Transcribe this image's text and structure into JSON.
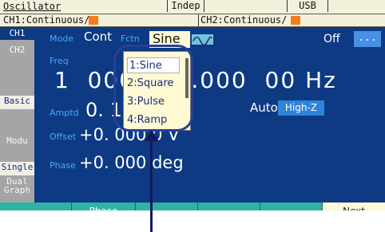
{
  "topbar": {
    "title": "Oscillator",
    "indep": "Indep",
    "usb": "USB"
  },
  "status": {
    "ch1": "CH1:Continuous/",
    "ch2": "CH2:Continuous/",
    "indicator_color": "#f47b20"
  },
  "tabs": {
    "ch1": "CH1",
    "ch2": "CH2",
    "basic": "Basic",
    "modu": "Modu",
    "single": "Single",
    "dual_line1": "Dual",
    "dual_line2": "Graph"
  },
  "main": {
    "mode_label": "Mode",
    "mode_value": "Cont",
    "fctn_label": "Fctn",
    "fctn_value": "Sine",
    "output_state": "Off",
    "more_button": "...",
    "freq_label": "Freq",
    "freq_value": "1  000 000.000  00 Hz",
    "amptd_label": "Amptd",
    "amptd_value": "0. 100 Vpp",
    "load_mode": "Auto",
    "load_value": "High-Z",
    "offset_label": "Offset",
    "offset_value": "+0. 000 0 V",
    "phase_label": "Phase",
    "phase_value": "+0. 000 deg"
  },
  "dropdown": {
    "options": [
      "1:Sine",
      "2:Square",
      "3:Pulse",
      "4:Ramp"
    ],
    "selected_index": 0
  },
  "softkeys": [
    "",
    "Phase",
    "",
    "",
    "",
    "Next"
  ],
  "colors": {
    "screen_bg": "#0d3a82",
    "label_blue": "#4aa7ff",
    "softkey": "#2fb3a2",
    "highlight": "#fff9d4",
    "callout": "#2a3d9a"
  }
}
